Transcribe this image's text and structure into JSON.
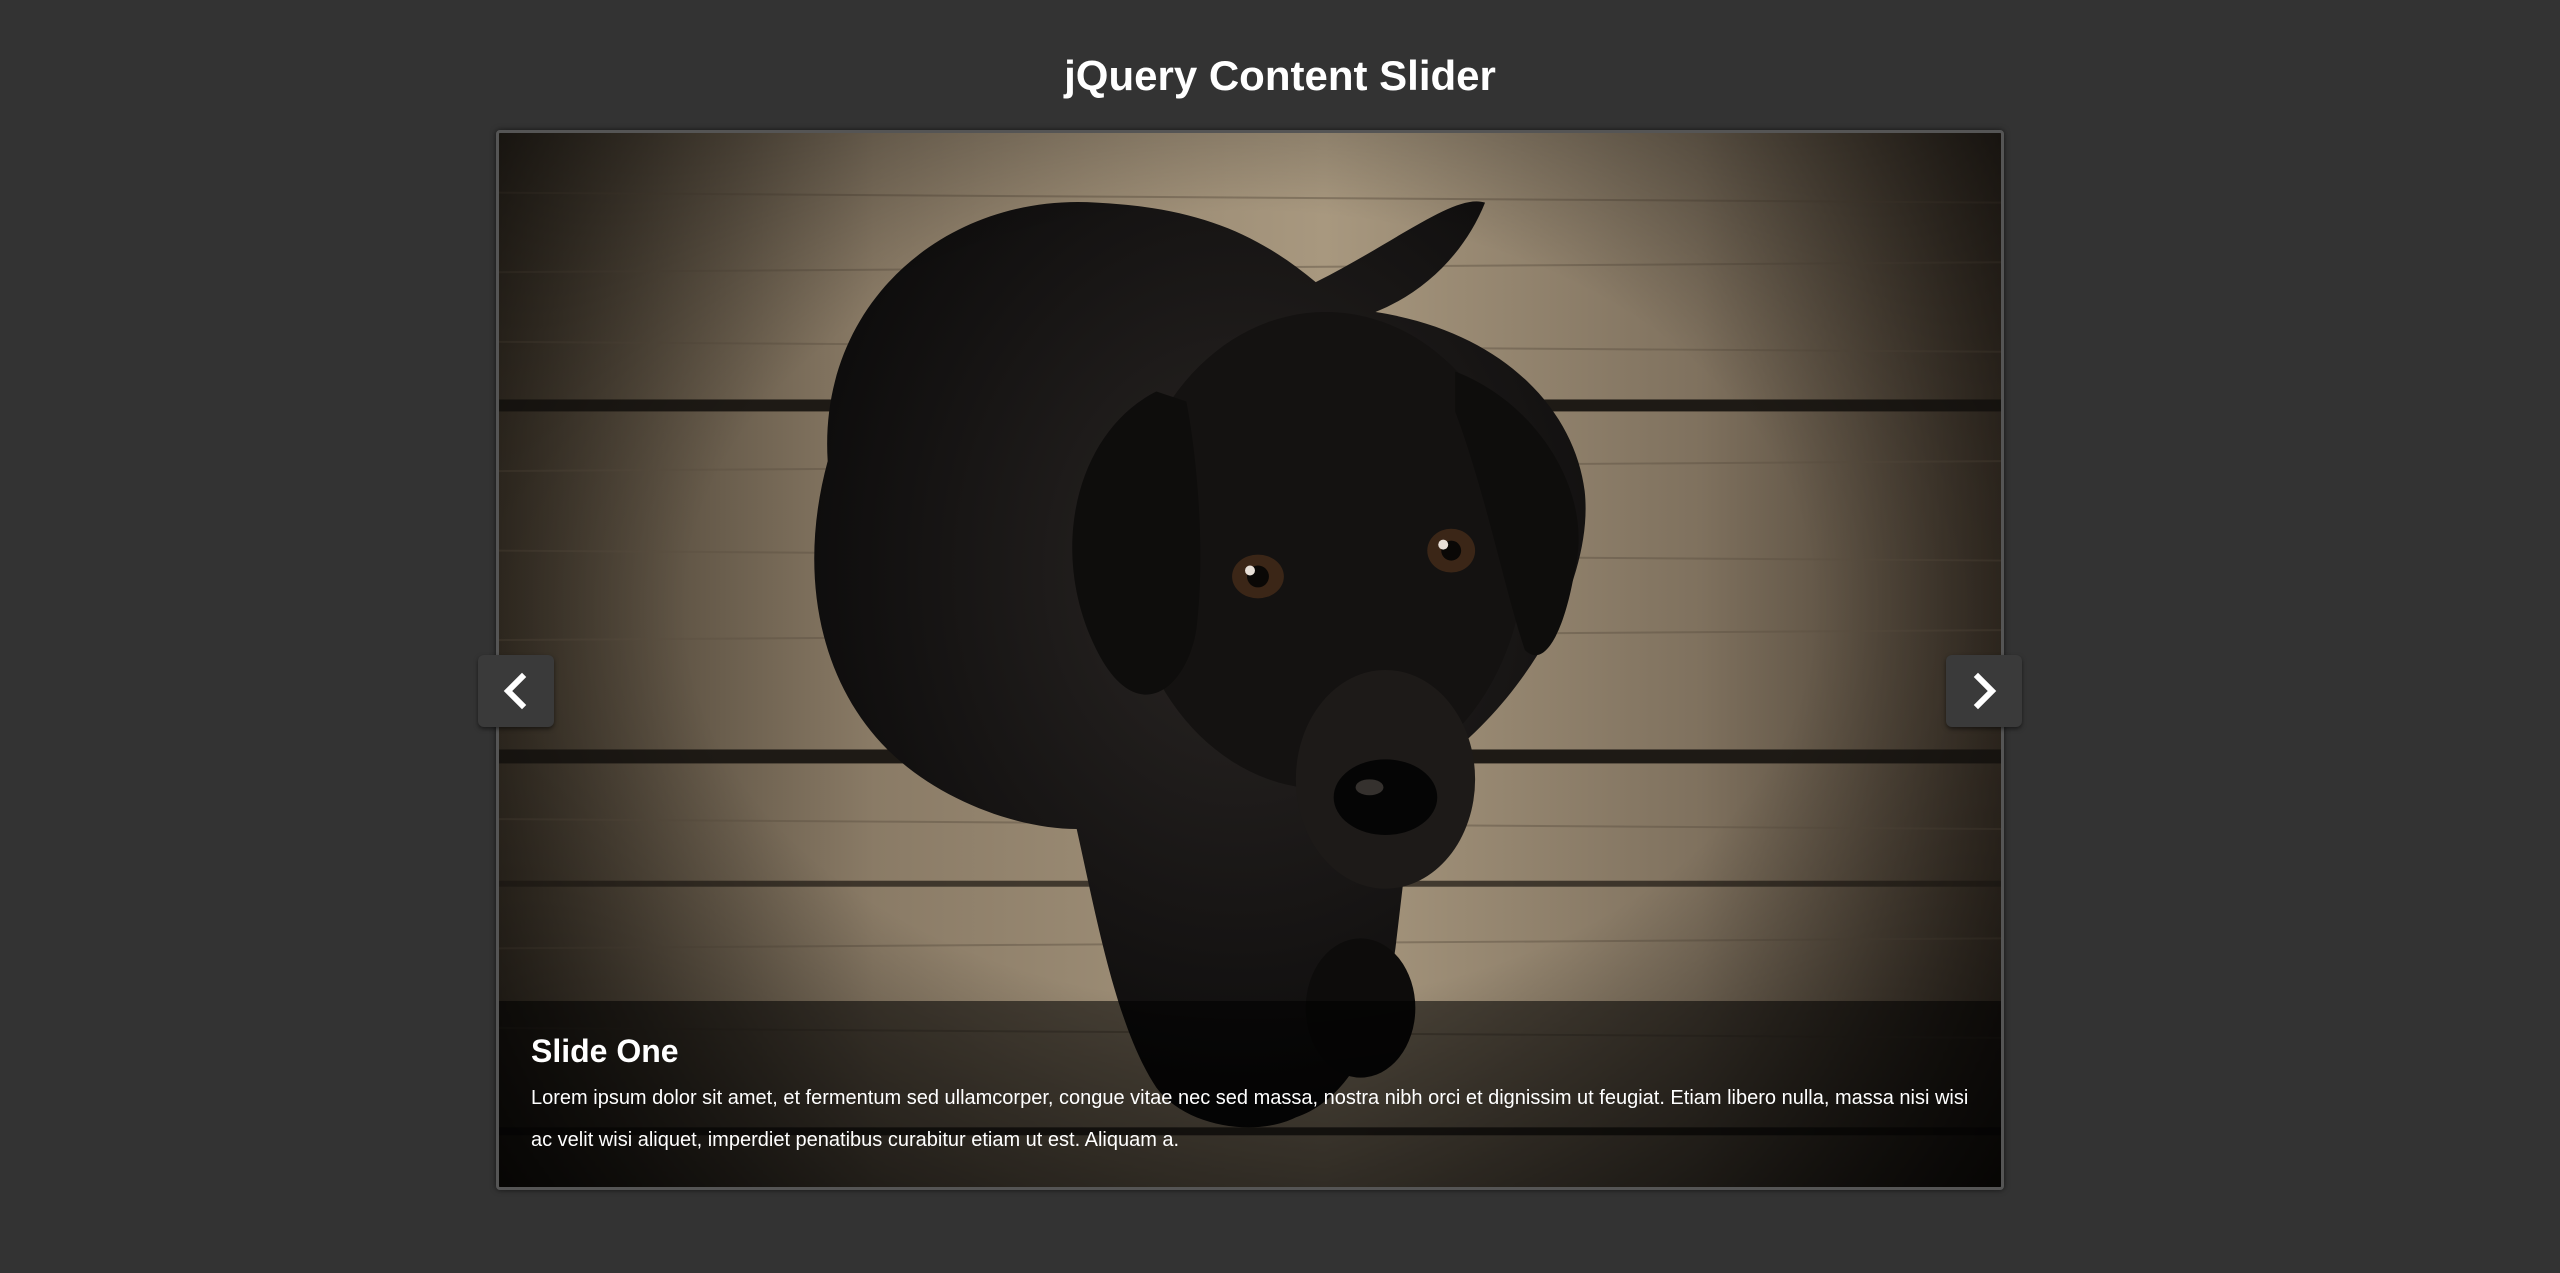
{
  "page": {
    "title": "jQuery Content Slider"
  },
  "slider": {
    "current_slide": {
      "title": "Slide One",
      "description": "Lorem ipsum dolor sit amet, et fermentum sed ullamcorper, congue vitae nec sed massa, nostra nibh orci et dignissim ut feugiat. Etiam libero nulla, massa nisi wisi ac velit wisi aliquet, imperdiet penatibus curabitur etiam ut est. Aliquam a.",
      "image": "black-puppy-on-wooden-deck"
    },
    "prev_icon": "chevron-left-icon",
    "next_icon": "chevron-right-icon"
  },
  "colors": {
    "background": "#333333",
    "text": "#ffffff",
    "nav_button": "#3a3a3a",
    "caption_overlay": "rgba(0,0,0,0.55)"
  }
}
